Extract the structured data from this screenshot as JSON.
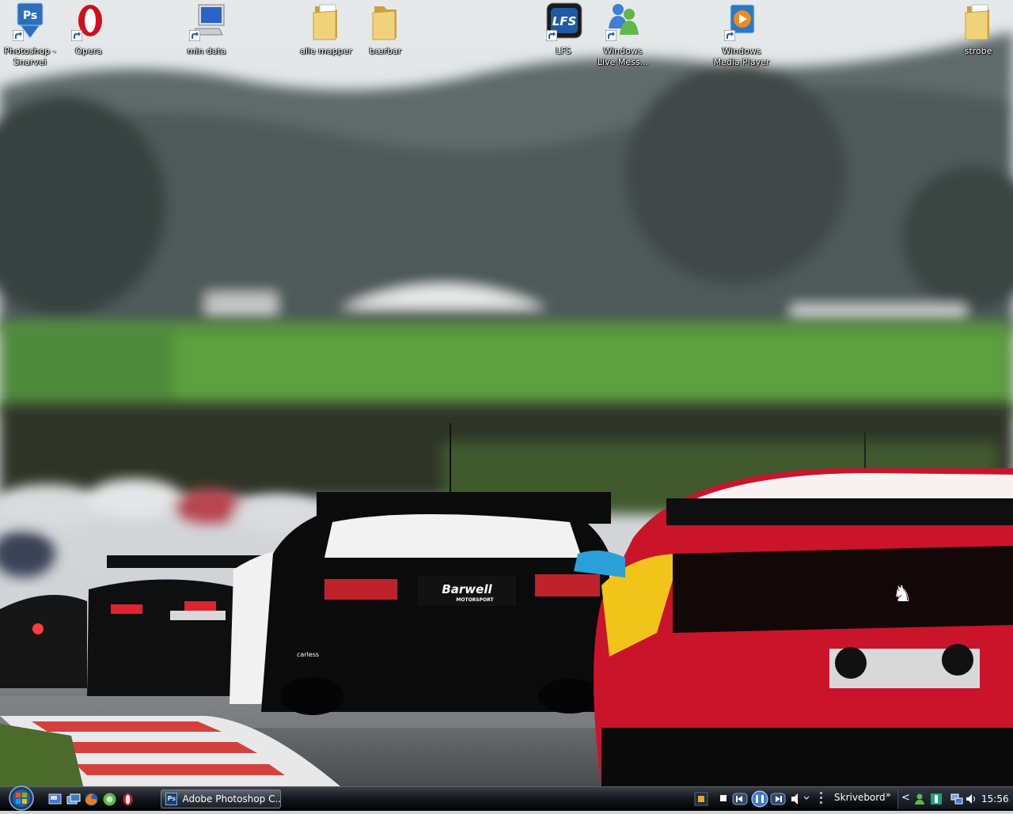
{
  "desktop": {
    "icons": [
      {
        "id": "photoshop",
        "label": "Photoshop -\nSnarvei",
        "icon": "photoshop-icon",
        "shortcut": true
      },
      {
        "id": "opera",
        "label": "Opera",
        "icon": "opera-icon",
        "shortcut": true
      },
      {
        "id": "min-data",
        "label": "min data",
        "icon": "computer-icon",
        "shortcut": true
      },
      {
        "id": "alle-mapper",
        "label": "alle mapper",
        "icon": "folder-icon",
        "shortcut": false
      },
      {
        "id": "baerbar",
        "label": "bærbar",
        "icon": "folder-icon",
        "shortcut": false
      },
      {
        "id": "lfs",
        "label": "LFS",
        "icon": "lfs-icon",
        "shortcut": true
      },
      {
        "id": "messenger",
        "label": "Windows\nLive Mess...",
        "icon": "messenger-icon",
        "shortcut": true
      },
      {
        "id": "media-player",
        "label": "Windows\nMedia Player",
        "icon": "media-player-icon",
        "shortcut": true
      },
      {
        "id": "strobe",
        "label": "strobe",
        "icon": "folder-icon",
        "shortcut": false
      }
    ],
    "wallpaper": {
      "subject": "race-cars-on-track",
      "car_decal": "Barwell",
      "car_decal_sub": "MOTORSPORT",
      "sticker": "carless"
    }
  },
  "taskbar": {
    "start_icon": "windows-orb-icon",
    "quick_launch": [
      "show-desktop-icon",
      "switch-windows-icon",
      "firefox-icon",
      "green-app-icon",
      "opera-icon"
    ],
    "tasks": [
      {
        "label": "Adobe Photoshop C...",
        "icon": "photoshop-icon"
      }
    ],
    "media_toolbar": [
      "stop-icon",
      "previous-icon",
      "pause-icon",
      "next-icon",
      "volume-icon"
    ],
    "toolbar_label": "Skrivebord",
    "toolbar_chevron": "»",
    "tray_expand": "<",
    "tray_icons": [
      "messenger-status-icon",
      "app-tray-icon",
      "network-icon",
      "volume-icon"
    ],
    "clock": "15:56"
  },
  "colors": {
    "taskbar": "#000000",
    "accent": "#3b78c4",
    "folder": "#e8c65a"
  }
}
